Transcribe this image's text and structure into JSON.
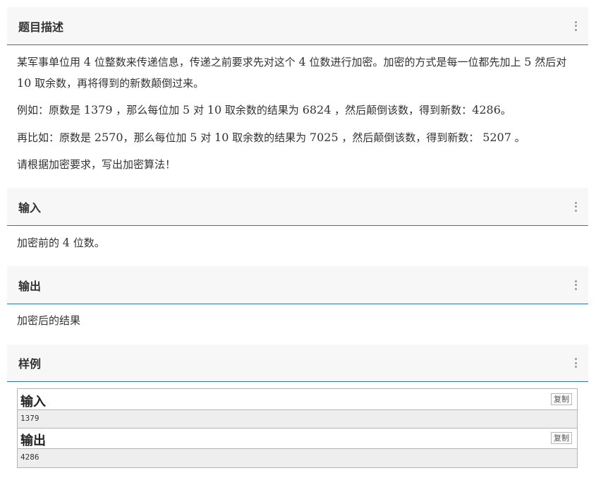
{
  "sections": {
    "description": {
      "title": "题目描述",
      "p1": [
        "某军事单位用 ",
        "4",
        " 位整数来传递信息，传递之前要求先对这个 ",
        "4",
        " 位数进行加密。加密的方式是每一位都先加上 ",
        "5",
        " 然后对 ",
        "10",
        " 取余数，再将得到的新数颠倒过来。"
      ],
      "p2": [
        "例如：原数是 ",
        "1379",
        " ，那么每位加 ",
        "5",
        " 对 ",
        "10",
        " 取余数的结果为 ",
        "6824",
        " ，然后颠倒该数，得到新数：",
        "4286",
        "。"
      ],
      "p3": [
        "再比如：原数是 ",
        "2570",
        "，那么每位加 ",
        "5",
        " 对 ",
        "10",
        " 取余数的结果为 ",
        "7025",
        " ，然后颠倒该数，得到新数：  ",
        "5207",
        " 。"
      ],
      "p4": "请根据加密要求，写出加密算法！"
    },
    "input": {
      "title": "输入",
      "text": [
        "加密前的 ",
        "4",
        " 位数。"
      ]
    },
    "output": {
      "title": "输出",
      "text": "加密后的结果"
    },
    "sample": {
      "title": "样例",
      "input_label": "输入",
      "input_value": "1379",
      "output_label": "输出",
      "output_value": "4286",
      "copy_label": "复制"
    }
  },
  "colors": {
    "header_bg": "#f7f7f7",
    "header_border": "#3273b8",
    "text": "#333333",
    "sample_value_bg": "#eeeeee"
  },
  "icons": {
    "menu": "kebab-menu-icon"
  }
}
